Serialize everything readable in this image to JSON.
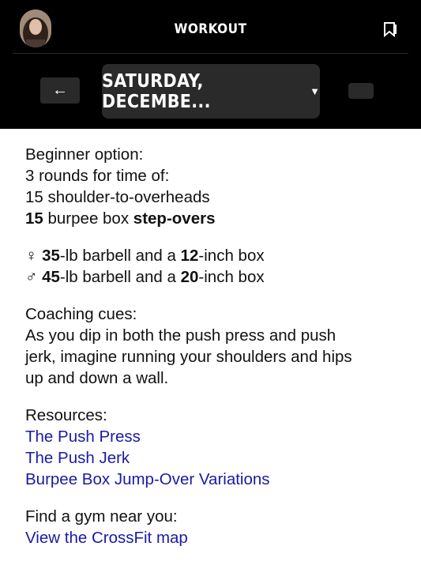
{
  "header": {
    "title": "WORKOUT"
  },
  "date_selector": {
    "label": "SATURDAY, DECEMBE...",
    "caret": "▼"
  },
  "nav": {
    "back": "←"
  },
  "beginner": {
    "heading": "Beginner option:",
    "lines": [
      "3 rounds for time of:",
      "15 shoulder-to-overheads"
    ],
    "burpee": {
      "num": "15",
      "text": " burpee box ",
      "bold": "step-overs"
    }
  },
  "loads": {
    "female": {
      "symbol": "♀",
      "weight": "35",
      "mid": "-lb barbell and a ",
      "box": "12",
      "end": "-inch box"
    },
    "male": {
      "symbol": "♂",
      "weight": "45",
      "mid": "-lb barbell and a ",
      "box": "20",
      "end": "-inch box"
    }
  },
  "coaching": {
    "heading": "Coaching cues:",
    "lines": [
      "As you dip in both the push press and push",
      "jerk, imagine running your shoulders and hips",
      "up and down a wall."
    ]
  },
  "resources": {
    "heading": "Resources:",
    "links": [
      "The Push Press",
      "The Push Jerk",
      "Burpee Box Jump-Over Variations"
    ]
  },
  "gym": {
    "heading": "Find a gym near you:",
    "link": "View the CrossFit map"
  },
  "colors": {
    "header_bg": "#000000",
    "button_bg": "#2a2a2a",
    "link": "#1a1aa6"
  }
}
